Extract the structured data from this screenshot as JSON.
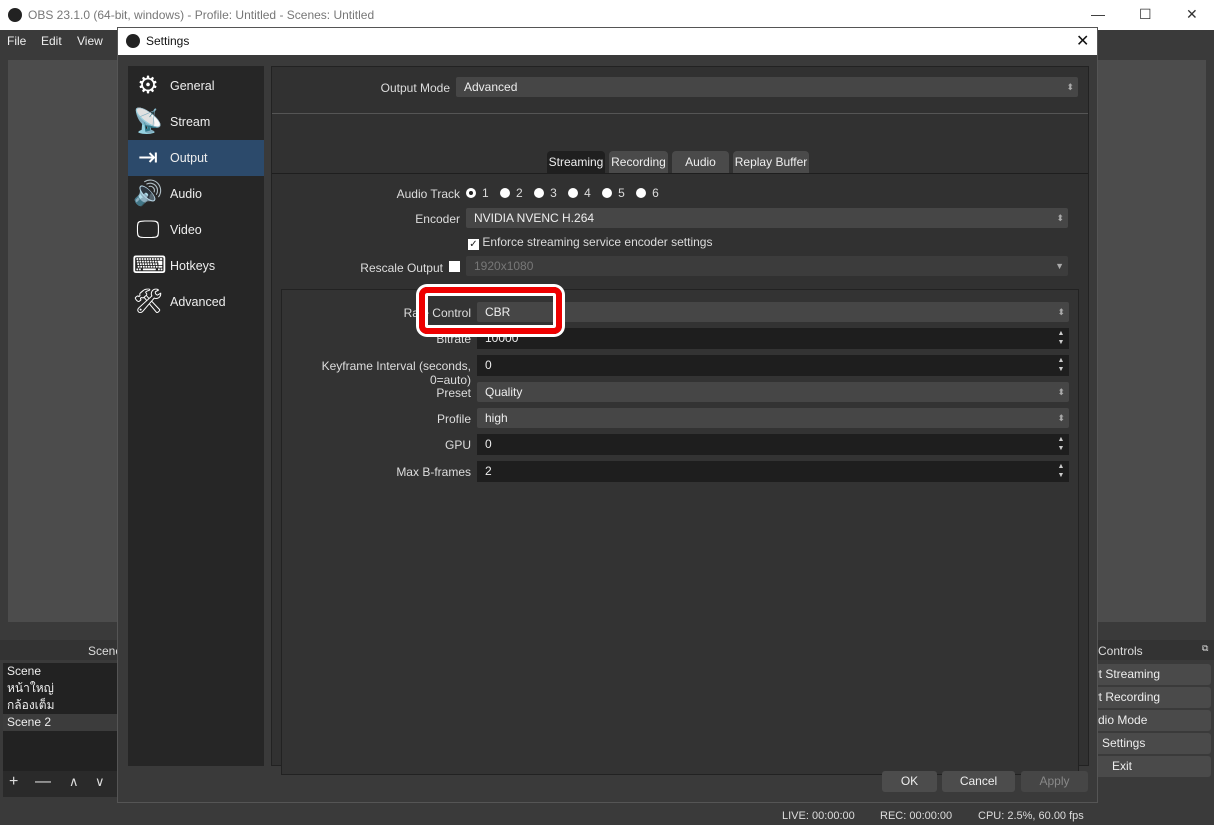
{
  "app": {
    "title": "OBS 23.1.0 (64-bit, windows) - Profile: Untitled - Scenes: Untitled",
    "menu": [
      "File",
      "Edit",
      "View"
    ],
    "win_controls": [
      "—",
      "☐",
      "✕"
    ]
  },
  "scenes": {
    "header": "Scene",
    "items": [
      "Scene",
      "หน้าใหญ่",
      "กล้องเต็ม",
      "Scene 2"
    ],
    "selected": "Scene 2",
    "tools": [
      "+",
      "—",
      "∧",
      "∨"
    ]
  },
  "controls": {
    "header": "Controls",
    "buttons": [
      "art Streaming",
      "art Recording",
      "tudio Mode",
      "Settings",
      "Exit"
    ]
  },
  "status": {
    "live": "LIVE: 00:00:00",
    "rec": "REC: 00:00:00",
    "cpu": "CPU: 2.5%, 60.00 fps"
  },
  "dialog": {
    "title": "Settings",
    "close": "✕",
    "sidebar": [
      {
        "label": "General",
        "icon": "⚙"
      },
      {
        "label": "Stream",
        "icon": "📡"
      },
      {
        "label": "Output",
        "icon": "⇥"
      },
      {
        "label": "Audio",
        "icon": "🔊"
      },
      {
        "label": "Video",
        "icon": "🖵"
      },
      {
        "label": "Hotkeys",
        "icon": "⌨"
      },
      {
        "label": "Advanced",
        "icon": "🛠"
      }
    ],
    "selected": "Output",
    "output_mode": {
      "label": "Output Mode",
      "value": "Advanced"
    },
    "tabs": [
      "Streaming",
      "Recording",
      "Audio",
      "Replay Buffer"
    ],
    "active_tab": "Streaming",
    "audio_track": {
      "label": "Audio Track",
      "tracks": [
        "1",
        "2",
        "3",
        "4",
        "5",
        "6"
      ],
      "selected": "1"
    },
    "encoder": {
      "label": "Encoder",
      "value": "NVIDIA NVENC H.264"
    },
    "enforce": {
      "label": "Enforce streaming service encoder settings",
      "checked": true
    },
    "rescale": {
      "label": "Rescale Output",
      "checked": false,
      "value": "1920x1080"
    },
    "rate_control": {
      "label": "Rate Control",
      "value": "CBR"
    },
    "bitrate": {
      "label": "Bitrate",
      "value": "10000"
    },
    "keyframe": {
      "label": "Keyframe Interval (seconds, 0=auto)",
      "value": "0"
    },
    "preset": {
      "label": "Preset",
      "value": "Quality"
    },
    "profile": {
      "label": "Profile",
      "value": "high"
    },
    "gpu": {
      "label": "GPU",
      "value": "0"
    },
    "bframes": {
      "label": "Max B-frames",
      "value": "2"
    },
    "buttons": {
      "ok": "OK",
      "cancel": "Cancel",
      "apply": "Apply"
    }
  }
}
